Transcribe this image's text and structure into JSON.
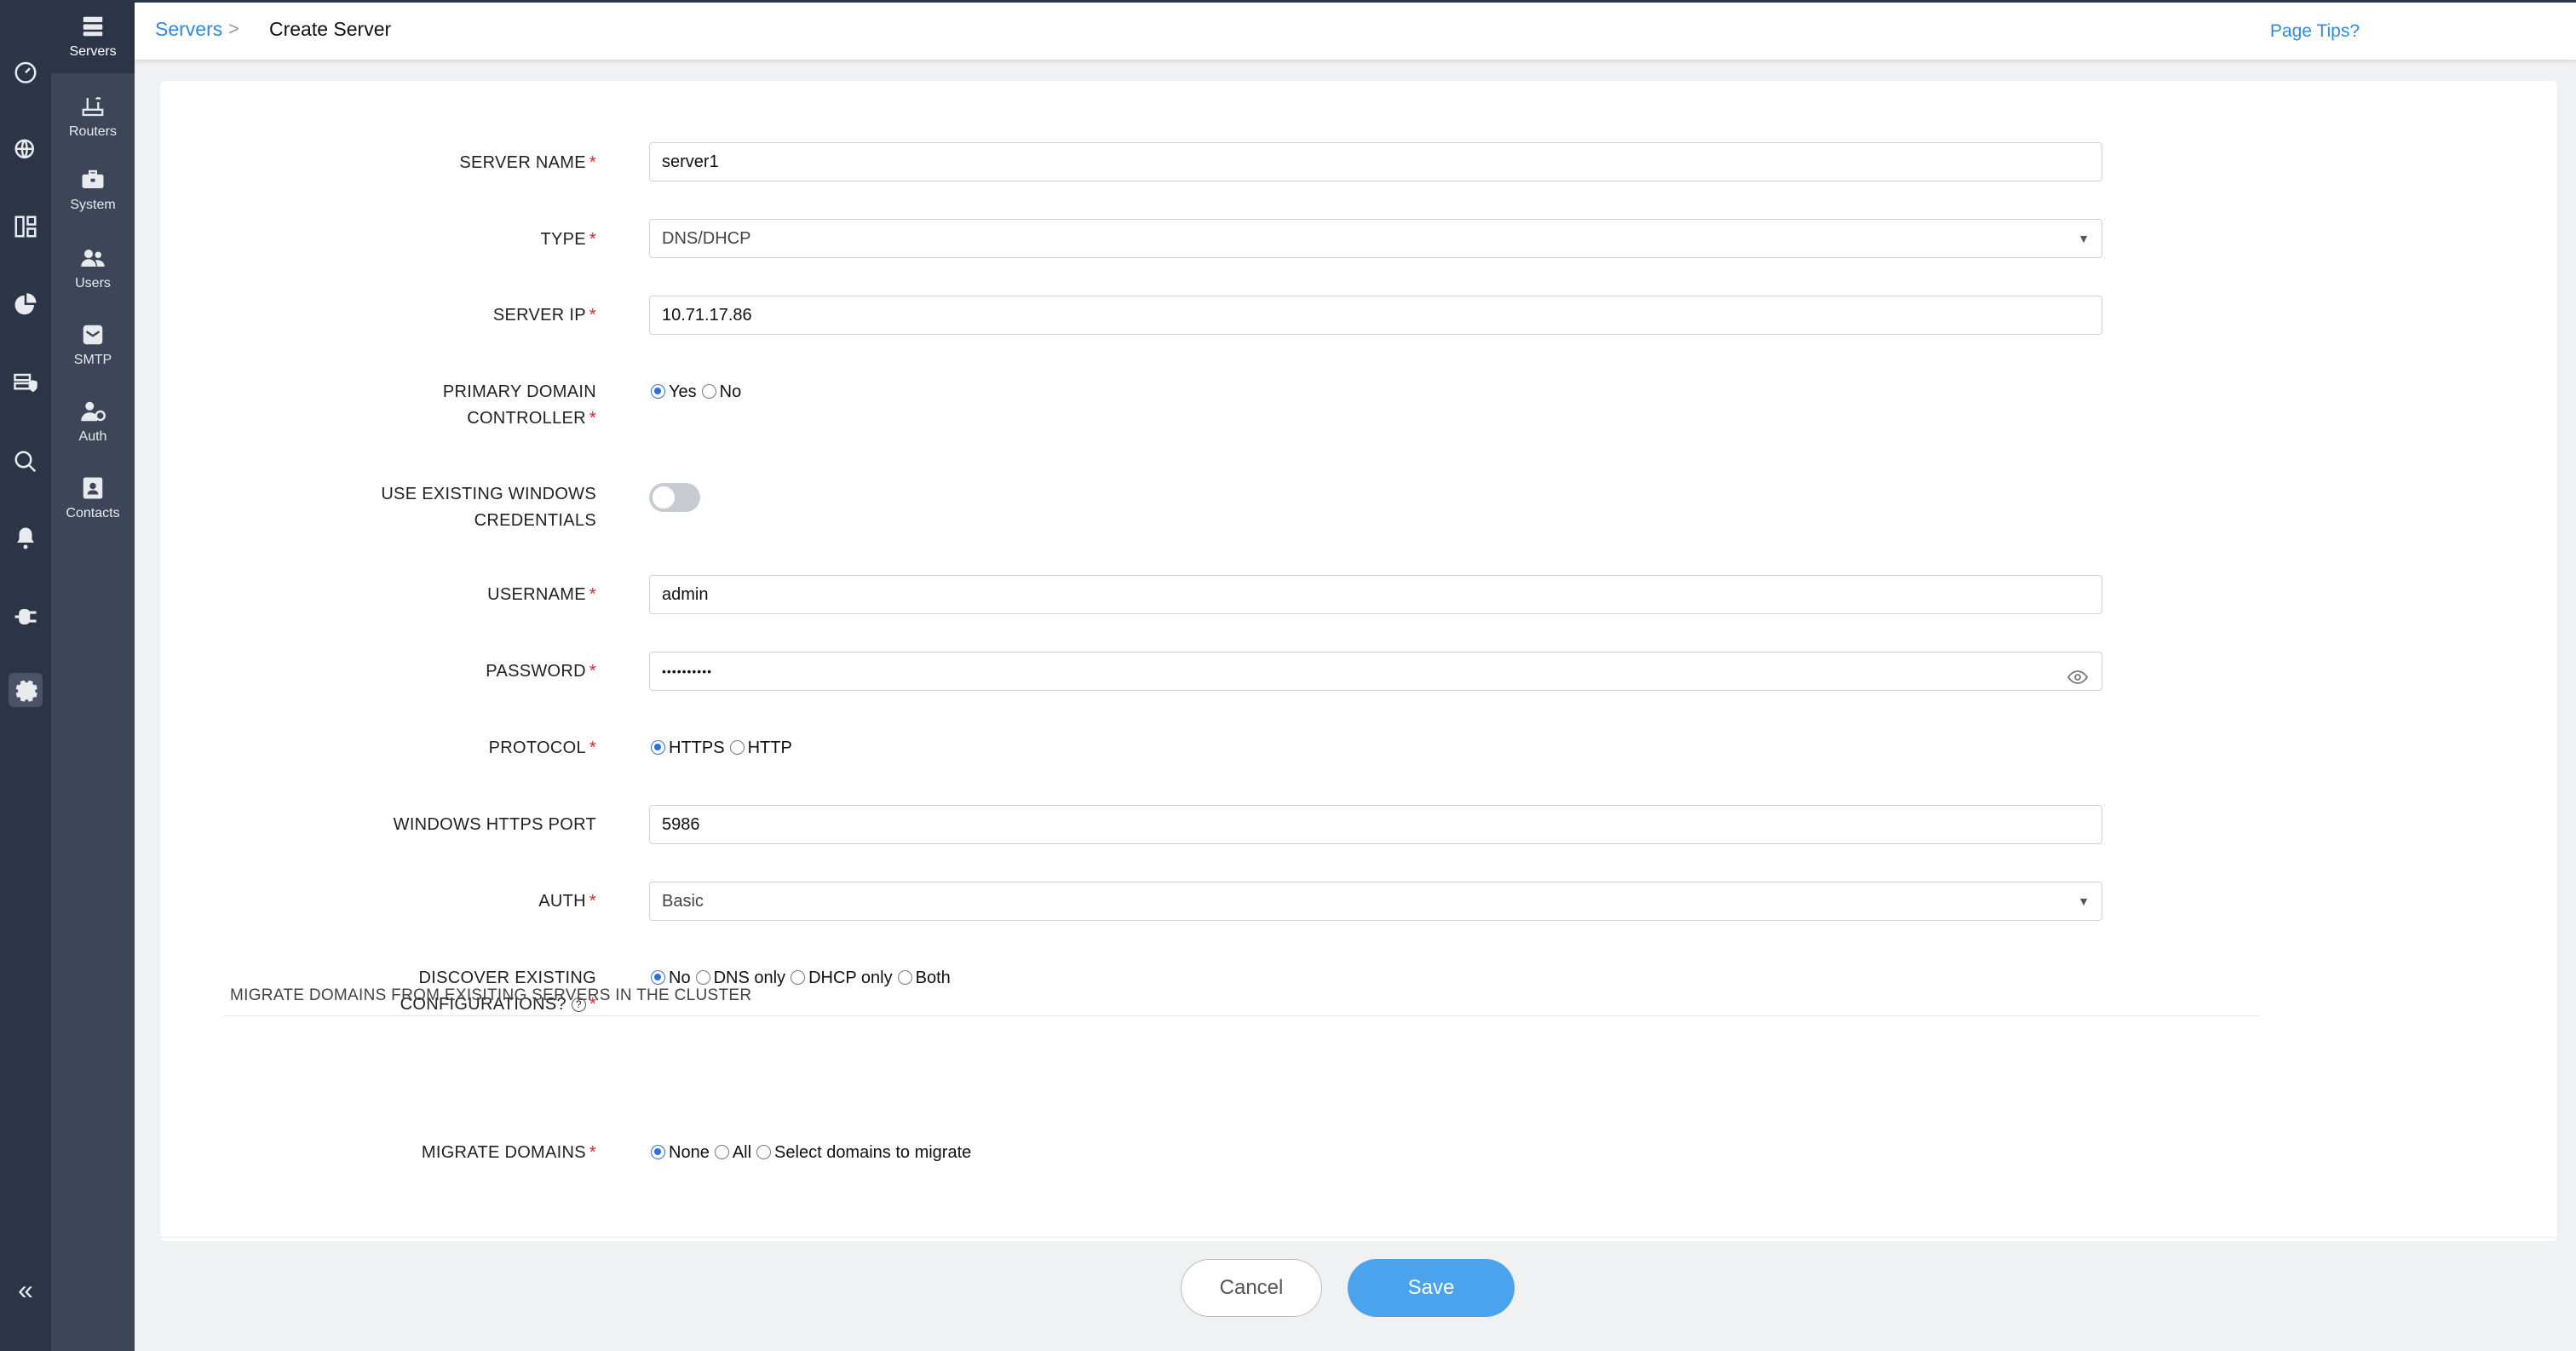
{
  "rail": {
    "icons": [
      "dashboard-icon",
      "dns-globe-icon",
      "network-icon",
      "pie-chart-icon",
      "server-shield-icon",
      "search-analytics-icon",
      "bell-icon",
      "plug-icon",
      "settings-gear-icon"
    ],
    "collapse_label": "«"
  },
  "subnav": {
    "items": [
      {
        "label": "Servers",
        "icon": "servers-icon"
      },
      {
        "label": "Routers",
        "icon": "router-icon"
      },
      {
        "label": "System",
        "icon": "toolbox-icon"
      },
      {
        "label": "Users",
        "icon": "users-icon"
      },
      {
        "label": "SMTP",
        "icon": "mail-icon"
      },
      {
        "label": "Auth",
        "icon": "auth-user-icon"
      },
      {
        "label": "Contacts",
        "icon": "contacts-icon"
      }
    ]
  },
  "header": {
    "breadcrumb_link": "Servers",
    "breadcrumb_sep": ">",
    "breadcrumb_current": "Create Server",
    "page_tips": "Page Tips?"
  },
  "form": {
    "server_name": {
      "label": "SERVER NAME",
      "value": "server1"
    },
    "type": {
      "label": "TYPE",
      "value": "DNS/DHCP"
    },
    "server_ip": {
      "label": "SERVER IP",
      "value": "10.71.17.86"
    },
    "primary_dc": {
      "label_line1": "PRIMARY DOMAIN",
      "label_line2": "CONTROLLER",
      "options": [
        "Yes",
        "No"
      ],
      "selected": "Yes"
    },
    "use_existing": {
      "label_line1": "USE EXISTING WINDOWS",
      "label_line2": "CREDENTIALS",
      "enabled": false
    },
    "username": {
      "label": "USERNAME",
      "value": "admin"
    },
    "password": {
      "label": "PASSWORD",
      "value": "••••••••••"
    },
    "protocol": {
      "label": "PROTOCOL",
      "options": [
        "HTTPS",
        "HTTP"
      ],
      "selected": "HTTPS"
    },
    "https_port": {
      "label": "WINDOWS HTTPS PORT",
      "value": "5986"
    },
    "auth": {
      "label": "AUTH",
      "value": "Basic"
    },
    "discover": {
      "label_line1": "DISCOVER EXISTING",
      "label_line2": "CONFIGURATIONS?",
      "options": [
        "No",
        "DNS only",
        "DHCP only",
        "Both"
      ],
      "selected": "No"
    },
    "section_title": "MIGRATE DOMAINS FROM EXISITING SERVERS IN THE CLUSTER",
    "migrate": {
      "label": "MIGRATE DOMAINS",
      "options": [
        "None",
        "All",
        "Select domains to migrate"
      ],
      "selected": "None"
    },
    "required_mark": "*"
  },
  "footer": {
    "cancel_label": "Cancel",
    "save_label": "Save"
  },
  "colors": {
    "rail": "#2c3447",
    "subnav": "#3d4558",
    "accent": "#2d8ae0",
    "save": "#4aa3ec",
    "required": "#e0232b"
  }
}
